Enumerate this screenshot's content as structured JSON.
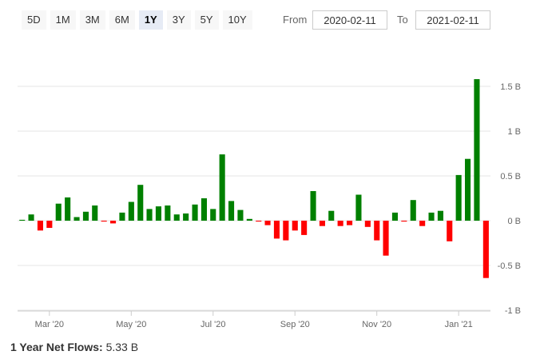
{
  "ranges": [
    "5D",
    "1M",
    "3M",
    "6M",
    "1Y",
    "3Y",
    "5Y",
    "10Y"
  ],
  "selected_range": "1Y",
  "date_range": {
    "from_label": "From",
    "from_value": "2020-02-11",
    "to_label": "To",
    "to_value": "2021-02-11"
  },
  "summary": {
    "label": "1 Year Net Flows:",
    "value": "5.33 B"
  },
  "colors": {
    "positive": "#008000",
    "negative": "#ff0000"
  },
  "chart_data": {
    "type": "bar",
    "ylim": [
      -1,
      1.5
    ],
    "y_ticks": [
      {
        "value": 1.5,
        "label": "1.5 B"
      },
      {
        "value": 1,
        "label": "1 B"
      },
      {
        "value": 0.5,
        "label": "0.5 B"
      },
      {
        "value": 0,
        "label": "0 B"
      },
      {
        "value": -0.5,
        "label": "-0.5 B"
      },
      {
        "value": -1,
        "label": "-1 B"
      }
    ],
    "x_ticks": [
      {
        "week": 3,
        "label": "Mar '20"
      },
      {
        "week": 12,
        "label": "May '20"
      },
      {
        "week": 21,
        "label": "Jul '20"
      },
      {
        "week": 30,
        "label": "Sep '20"
      },
      {
        "week": 39,
        "label": "Nov '20"
      },
      {
        "week": 48,
        "label": "Jan '21"
      }
    ],
    "values": [
      0.01,
      0.07,
      -0.11,
      -0.08,
      0.19,
      0.26,
      0.04,
      0.1,
      0.17,
      -0.01,
      -0.03,
      0.09,
      0.21,
      0.4,
      0.13,
      0.16,
      0.17,
      0.07,
      0.08,
      0.18,
      0.25,
      0.13,
      0.74,
      0.22,
      0.12,
      0.02,
      -0.01,
      -0.05,
      -0.2,
      -0.22,
      -0.11,
      -0.16,
      0.33,
      -0.06,
      0.11,
      -0.06,
      -0.05,
      0.29,
      -0.07,
      -0.22,
      -0.39,
      0.09,
      -0.01,
      0.23,
      -0.06,
      0.09,
      0.11,
      -0.23,
      0.51,
      0.69,
      1.58,
      -0.64
    ]
  }
}
